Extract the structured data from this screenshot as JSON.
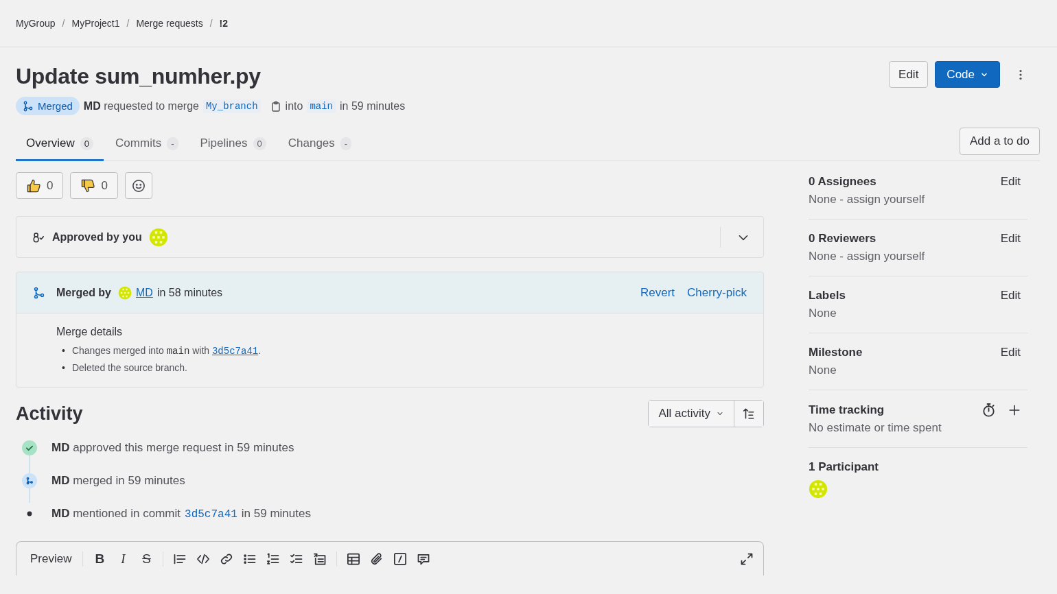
{
  "breadcrumbs": [
    {
      "label": "MyGroup",
      "current": false
    },
    {
      "label": "MyProject1",
      "current": false
    },
    {
      "label": "Merge requests",
      "current": false
    },
    {
      "label": "!2",
      "current": true
    }
  ],
  "breadcrumb_separator": "/",
  "title": "Update sum_numher.py",
  "header_buttons": {
    "edit": "Edit",
    "code": "Code"
  },
  "status_badge": "Merged",
  "meta": {
    "author": "MD",
    "text": "requested to merge",
    "source_branch": "My_branch",
    "into": "into",
    "target_branch": "main",
    "time": "in 59 minutes"
  },
  "tabs": [
    {
      "label": "Overview",
      "count": "0",
      "selected": true
    },
    {
      "label": "Commits",
      "count": "-",
      "selected": false
    },
    {
      "label": "Pipelines",
      "count": "0",
      "selected": false
    },
    {
      "label": "Changes",
      "count": "-",
      "selected": false
    }
  ],
  "todo_button": "Add a to do",
  "reactions": [
    {
      "kind": "thumbs-up",
      "count": "0"
    },
    {
      "kind": "thumbs-down",
      "count": "0"
    }
  ],
  "approval": {
    "text": "Approved by you"
  },
  "merge_widget": {
    "label": "Merged by",
    "user": "MD",
    "time": "in 58 minutes",
    "actions": [
      "Revert",
      "Cherry-pick"
    ],
    "details_title": "Merge details",
    "details": [
      {
        "bullet": "•",
        "text": "Changes merged into ",
        "code": "main",
        "middle": " with ",
        "link": "3d5c7a41",
        "end": "."
      },
      {
        "bullet": "•",
        "text": "Deleted the source branch."
      }
    ]
  },
  "activity": {
    "title": "Activity",
    "filter": "All activity",
    "items": [
      {
        "kind": "approved",
        "text": "**MD** approved this merge request in 59 minutes"
      },
      {
        "kind": "merged",
        "text": "**MD** merged in 59 minutes"
      },
      {
        "kind": "mentioned",
        "text": "**MD** mentioned in commit",
        "commit": "3d5c7a41",
        "time": "in 59 minutes"
      }
    ]
  },
  "editor": {
    "preview": "Preview",
    "tools": [
      {
        "kind": "bold",
        "glyph": "B"
      },
      {
        "kind": "italic",
        "glyph": "I"
      },
      {
        "kind": "strike",
        "glyph": "S"
      },
      {
        "kind": "sep"
      },
      {
        "kind": "quote"
      },
      {
        "kind": "code"
      },
      {
        "kind": "link"
      },
      {
        "kind": "bullets"
      },
      {
        "kind": "numbers"
      },
      {
        "kind": "tasks"
      },
      {
        "kind": "collapsible"
      },
      {
        "kind": "sep"
      },
      {
        "kind": "table"
      },
      {
        "kind": "attach"
      },
      {
        "kind": "slash"
      },
      {
        "kind": "comment"
      }
    ]
  },
  "sidebar": [
    {
      "kind": "editable",
      "title": "0 Assignees",
      "action": "Edit",
      "value": "None - assign yourself"
    },
    {
      "kind": "editable",
      "title": "0 Reviewers",
      "action": "Edit",
      "value": "None - assign yourself"
    },
    {
      "kind": "editable",
      "title": "Labels",
      "action": "Edit",
      "value": "None"
    },
    {
      "kind": "editable",
      "title": "Milestone",
      "action": "Edit",
      "value": "None"
    },
    {
      "kind": "time",
      "title": "Time tracking",
      "value": "No estimate or time spent"
    },
    {
      "kind": "participants",
      "title": "1 Participant"
    }
  ]
}
